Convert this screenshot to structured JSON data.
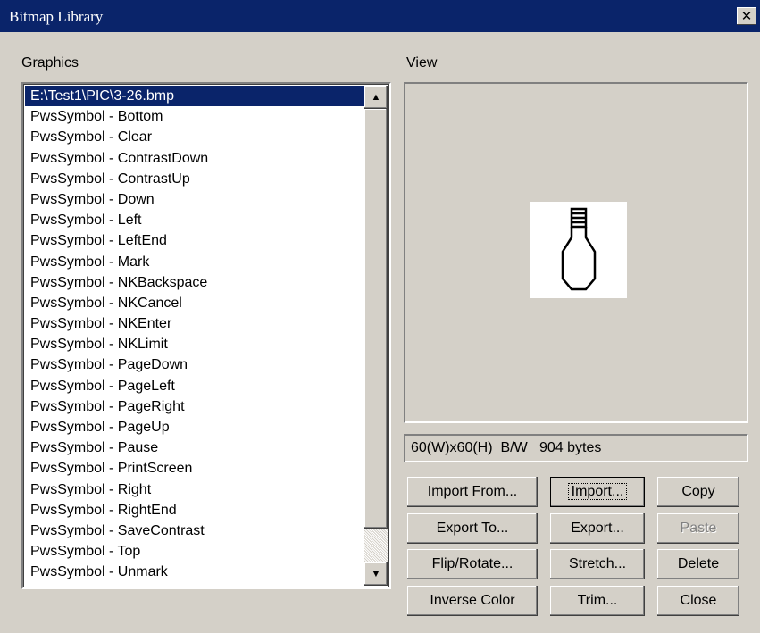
{
  "window": {
    "title": "Bitmap Library"
  },
  "labels": {
    "graphics": "Graphics",
    "view": "View"
  },
  "graphics_list": {
    "items": [
      "E:\\Test1\\PIC\\3-26.bmp",
      "PwsSymbol - Bottom",
      "PwsSymbol - Clear",
      "PwsSymbol - ContrastDown",
      "PwsSymbol - ContrastUp",
      "PwsSymbol - Down",
      "PwsSymbol - Left",
      "PwsSymbol - LeftEnd",
      "PwsSymbol - Mark",
      "PwsSymbol - NKBackspace",
      "PwsSymbol - NKCancel",
      "PwsSymbol - NKEnter",
      "PwsSymbol - NKLimit",
      "PwsSymbol - PageDown",
      "PwsSymbol - PageLeft",
      "PwsSymbol - PageRight",
      "PwsSymbol - PageUp",
      "PwsSymbol - Pause",
      "PwsSymbol - PrintScreen",
      "PwsSymbol - Right",
      "PwsSymbol - RightEnd",
      "PwsSymbol - SaveContrast",
      "PwsSymbol - Top",
      "PwsSymbol - Unmark"
    ],
    "selected_index": 0
  },
  "info": {
    "text": "60(W)x60(H)  B/W   904 bytes"
  },
  "buttons": {
    "import_from": "Import From...",
    "import": "Import...",
    "copy": "Copy",
    "export_to": "Export To...",
    "export": "Export...",
    "paste": "Paste",
    "flip_rotate": "Flip/Rotate...",
    "stretch": "Stretch...",
    "delete": "Delete",
    "inverse_color": "Inverse Color",
    "trim": "Trim...",
    "close": "Close"
  },
  "icons": {
    "close": "close-icon",
    "scroll_up": "scroll-up-icon",
    "scroll_down": "scroll-down-icon",
    "preview": "light-bulb-bitmap"
  },
  "colors": {
    "titlebar": "#0a246a",
    "selection": "#0a246a",
    "face": "#d4d0c8"
  }
}
